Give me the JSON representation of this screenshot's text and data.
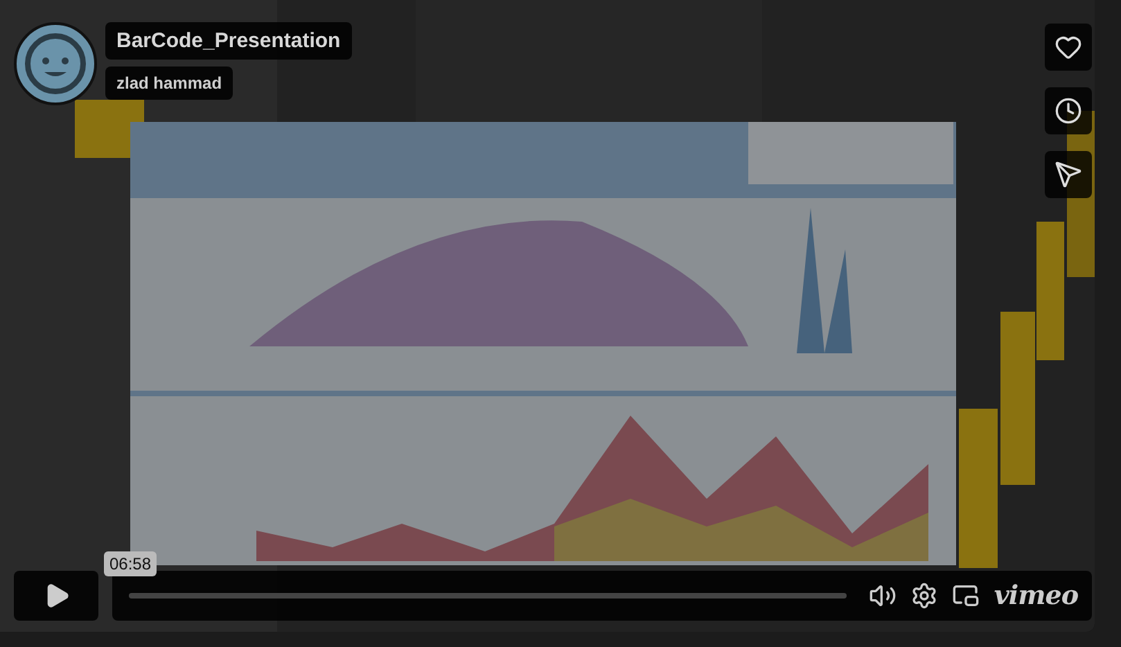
{
  "header": {
    "title": "BarCode_Presentation",
    "author": "zlad hammad"
  },
  "controls": {
    "hover_time": "06:58",
    "logo": "vimeo"
  }
}
